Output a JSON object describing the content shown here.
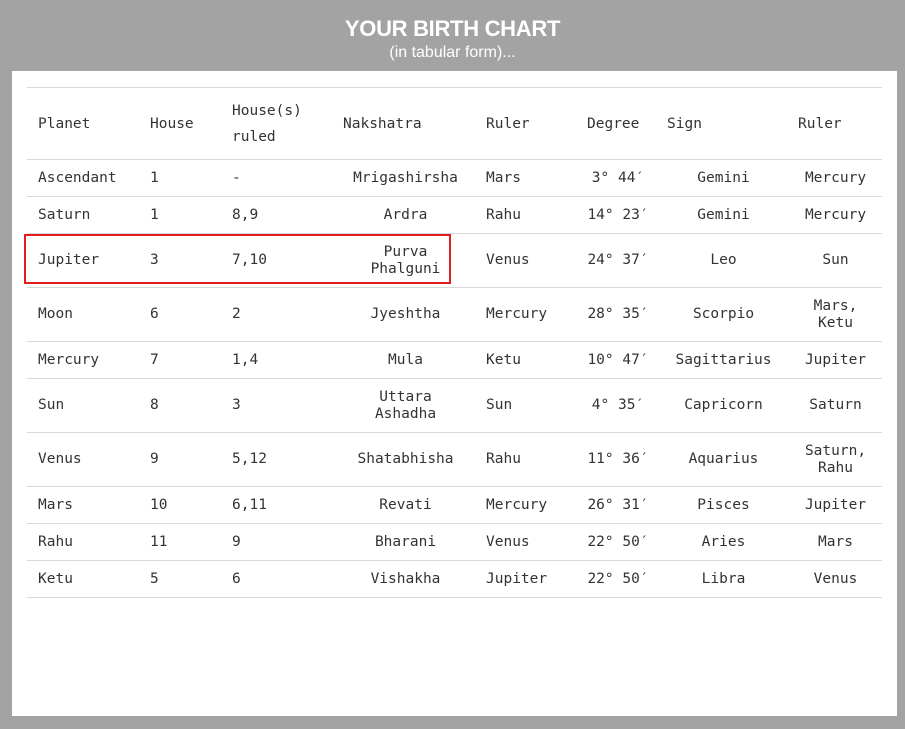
{
  "header": {
    "title": "YOUR BIRTH CHART",
    "subtitle": "(in tabular form)..."
  },
  "colors": {
    "frame": "#a3a3a3",
    "highlight": "#e01e1e"
  },
  "table": {
    "columns": [
      "Planet",
      "House",
      "House(s) ruled",
      "Nakshatra",
      "Ruler",
      "Degree",
      "Sign",
      "Ruler"
    ],
    "rows": [
      {
        "planet": "Ascendant",
        "house": "1",
        "ruled": "-",
        "nakshatra": "Mrigashirsha",
        "ruler": "Mars",
        "degree": "3° 44′",
        "sign": "Gemini",
        "sign_ruler": "Mercury"
      },
      {
        "planet": "Saturn",
        "house": "1",
        "ruled": "8,9",
        "nakshatra": "Ardra",
        "ruler": "Rahu",
        "degree": "14° 23′",
        "sign": "Gemini",
        "sign_ruler": "Mercury"
      },
      {
        "planet": "Jupiter",
        "house": "3",
        "ruled": "7,10",
        "nakshatra": "Purva Phalguni",
        "ruler": "Venus",
        "degree": "24° 37′",
        "sign": "Leo",
        "sign_ruler": "Sun"
      },
      {
        "planet": "Moon",
        "house": "6",
        "ruled": "2",
        "nakshatra": "Jyeshtha",
        "ruler": "Mercury",
        "degree": "28° 35′",
        "sign": "Scorpio",
        "sign_ruler": "Mars, Ketu"
      },
      {
        "planet": "Mercury",
        "house": "7",
        "ruled": "1,4",
        "nakshatra": "Mula",
        "ruler": "Ketu",
        "degree": "10° 47′",
        "sign": "Sagittarius",
        "sign_ruler": "Jupiter"
      },
      {
        "planet": "Sun",
        "house": "8",
        "ruled": "3",
        "nakshatra": "Uttara Ashadha",
        "ruler": "Sun",
        "degree": "4° 35′",
        "sign": "Capricorn",
        "sign_ruler": "Saturn"
      },
      {
        "planet": "Venus",
        "house": "9",
        "ruled": "5,12",
        "nakshatra": "Shatabhisha",
        "ruler": "Rahu",
        "degree": "11° 36′",
        "sign": "Aquarius",
        "sign_ruler": "Saturn, Rahu"
      },
      {
        "planet": "Mars",
        "house": "10",
        "ruled": "6,11",
        "nakshatra": "Revati",
        "ruler": "Mercury",
        "degree": "26° 31′",
        "sign": "Pisces",
        "sign_ruler": "Jupiter"
      },
      {
        "planet": "Rahu",
        "house": "11",
        "ruled": "9",
        "nakshatra": "Bharani",
        "ruler": "Venus",
        "degree": "22° 50′",
        "sign": "Aries",
        "sign_ruler": "Mars"
      },
      {
        "planet": "Ketu",
        "house": "5",
        "ruled": "6",
        "nakshatra": "Vishakha",
        "ruler": "Jupiter",
        "degree": "22° 50′",
        "sign": "Libra",
        "sign_ruler": "Venus"
      }
    ]
  }
}
